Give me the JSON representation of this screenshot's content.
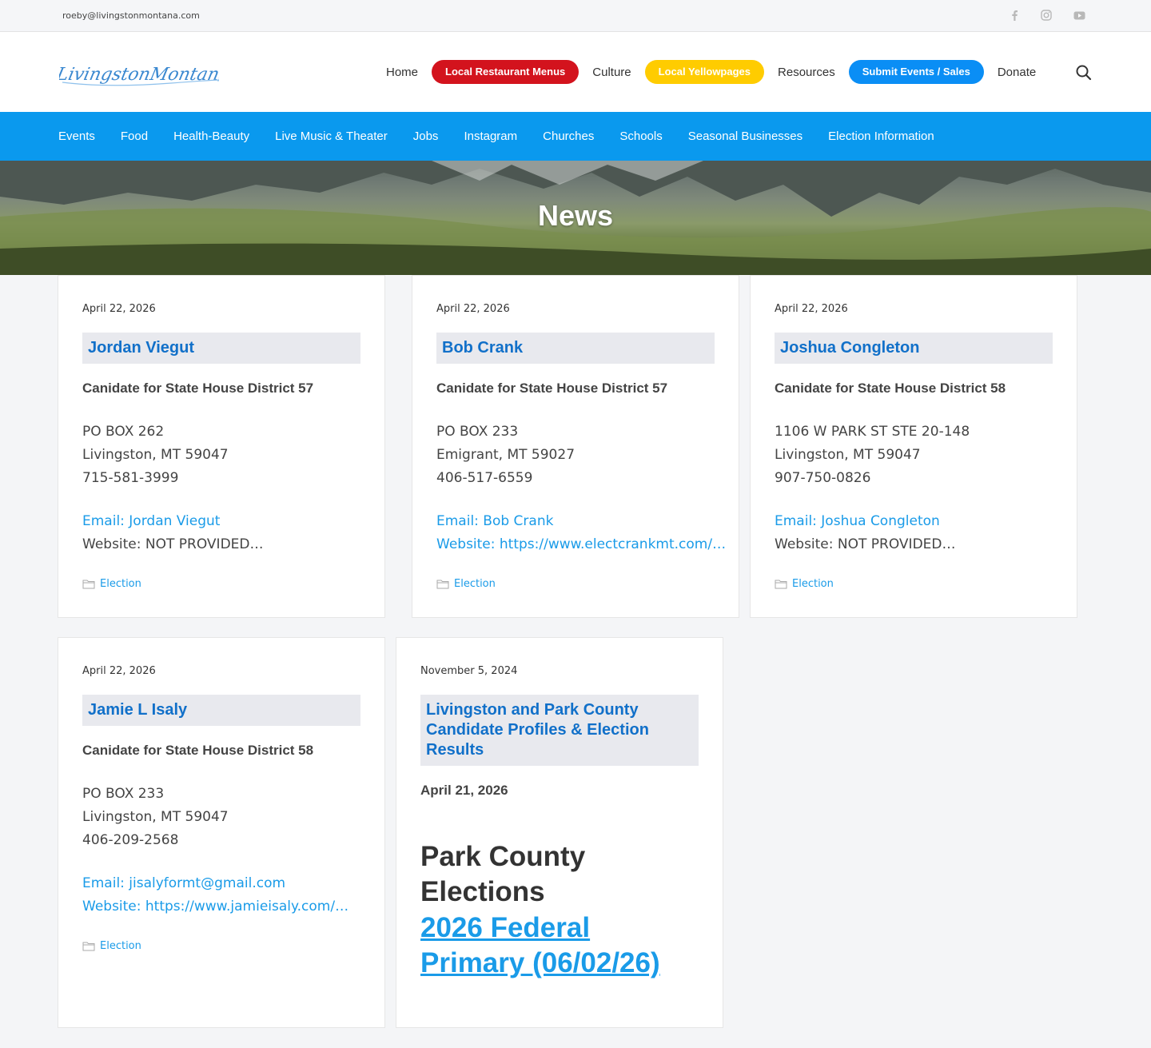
{
  "topbar": {
    "email": "roeby@livingstonmontana.com",
    "social_icons": [
      "facebook-icon",
      "instagram-icon",
      "youtube-icon"
    ]
  },
  "header": {
    "logo_text": "LivingstonMontana.com",
    "nav": [
      {
        "label": "Home",
        "style": "plain"
      },
      {
        "label": "Local Restaurant Menus",
        "style": "pill",
        "color": "#d3131d"
      },
      {
        "label": "Culture",
        "style": "plain"
      },
      {
        "label": "Local Yellowpages",
        "style": "pill",
        "color": "#ffcc00"
      },
      {
        "label": "Resources",
        "style": "plain"
      },
      {
        "label": "Submit Events / Sales",
        "style": "pill",
        "color": "#0a8ef5"
      },
      {
        "label": "Donate",
        "style": "plain"
      }
    ],
    "search_icon": "search-icon"
  },
  "subnav": {
    "color": "#0a99ee",
    "items": [
      "Events",
      "Food",
      "Health-Beauty",
      "Live Music & Theater",
      "Jobs",
      "Instagram",
      "Churches",
      "Schools",
      "Seasonal Businesses",
      "Election Information"
    ]
  },
  "hero": {
    "title": "News"
  },
  "cards": [
    {
      "date": "April 22, 2026",
      "title": "Jordan Viegut",
      "subtitle": "Canidate for State House District 57",
      "address": [
        "PO BOX 262",
        "Livingston, MT 59047",
        "715-581-3999"
      ],
      "email": "Email: Jordan Viegut",
      "website": "Website: NOT PROVIDED…",
      "website_is_link": false,
      "category": "Election"
    },
    {
      "date": "April 22, 2026",
      "title": "Bob Crank",
      "subtitle": "Canidate for State House District 57",
      "address": [
        "PO BOX 233",
        "Emigrant, MT 59027",
        "406-517-6559"
      ],
      "email": "Email: Bob Crank",
      "website": "Website: https://www.electcrankmt.com/…",
      "website_is_link": true,
      "category": "Election"
    },
    {
      "date": "April 22, 2026",
      "title": "Joshua Congleton",
      "subtitle": "Canidate for State House District 58",
      "address": [
        "1106 W PARK ST STE 20-148",
        "Livingston, MT 59047",
        "907-750-0826"
      ],
      "email": "Email: Joshua Congleton",
      "website": "Website: NOT PROVIDED…",
      "website_is_link": false,
      "category": "Election"
    },
    {
      "date": "April 22, 2026",
      "title": "Jamie L Isaly",
      "subtitle": "Canidate for State House District 58",
      "address": [
        "PO BOX 233",
        "Livingston, MT 59047",
        "406-209-2568"
      ],
      "email": "Email: jisalyformt@gmail.com",
      "website": "Website: https://www.jamieisaly.com/…",
      "website_is_link": true,
      "category": "Election"
    }
  ],
  "feature_card": {
    "date": "November 5, 2024",
    "title_lines": [
      "Livingston and Park County",
      "Candidate Profiles & Election",
      "Results"
    ],
    "subtitle": "April 21, 2026",
    "heading_lines": [
      "Park County",
      "Elections"
    ],
    "link_lines": [
      "2026 Federal",
      "Primary (06/02/26)"
    ]
  }
}
